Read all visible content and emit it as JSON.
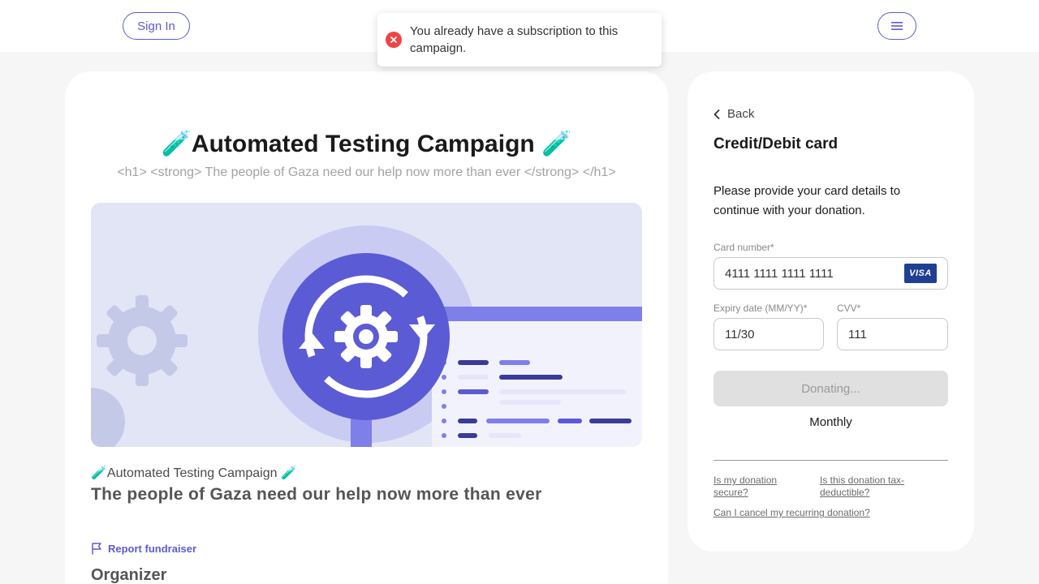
{
  "header": {
    "sign_in_label": "Sign In",
    "menu_icon": "hamburger-menu-icon"
  },
  "toast": {
    "message": "You already have a subscription to this campaign.",
    "icon": "error-x-icon",
    "icon_color": "#ef4444"
  },
  "campaign": {
    "title": "🧪Automated Testing Campaign 🧪",
    "subtitle": "<h1> <strong> The people of Gaza need our help now more than ever </strong> </h1>",
    "small_title": "🧪Automated Testing Campaign 🧪",
    "headline": "The people of Gaza need our help now more than ever",
    "report_label": "Report fundraiser",
    "organizer_label": "Organizer"
  },
  "payment": {
    "back_label": "Back",
    "title": "Credit/Debit card",
    "description": "Please provide your card details to continue with your donation.",
    "card_number_label": "Card number*",
    "card_number_value": "4111 1111 1111 1111",
    "card_brand": "VISA",
    "expiry_label": "Expiry date (MM/YY)*",
    "expiry_value": "11/30",
    "cvv_label": "CVV*",
    "cvv_value": "111",
    "donate_button_label": "Donating...",
    "frequency": "Monthly",
    "faq": {
      "secure": "Is my donation secure?",
      "tax": "Is this donation tax-deductible?",
      "cancel": "Can I cancel my recurring donation?"
    }
  },
  "colors": {
    "accent": "#5b5bd6",
    "error": "#ef4444",
    "visa": "#1f3f93"
  }
}
